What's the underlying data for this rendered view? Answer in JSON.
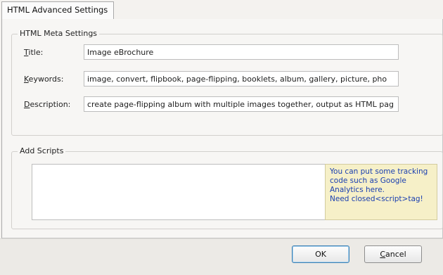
{
  "tab": {
    "label": "HTML Advanced Settings"
  },
  "meta_settings": {
    "legend": "HTML Meta Settings",
    "title": {
      "label_mnemonic": "T",
      "label_rest": "itle:",
      "value": "Image eBrochure"
    },
    "keywords": {
      "label_mnemonic": "K",
      "label_rest": "eywords:",
      "value": "image, convert, flipbook, page-flipping, booklets, album, gallery, picture, pho"
    },
    "description": {
      "label_mnemonic": "D",
      "label_rest": "escription:",
      "value": "create page-flipping album with multiple images together, output as HTML pag"
    }
  },
  "scripts": {
    "legend": "Add Scripts",
    "value": "",
    "hint_lines": [
      "You can put some tracking",
      "code such as Google",
      "Analytics here.",
      "Need closed<script>tag!"
    ]
  },
  "buttons": {
    "ok_label": "OK",
    "cancel_mnemonic": "C",
    "cancel_rest": "ancel"
  },
  "colors": {
    "hint_text": "#1a3fb0",
    "hint_background": "#f6f0c8",
    "window_background": "#f4f2ef"
  }
}
